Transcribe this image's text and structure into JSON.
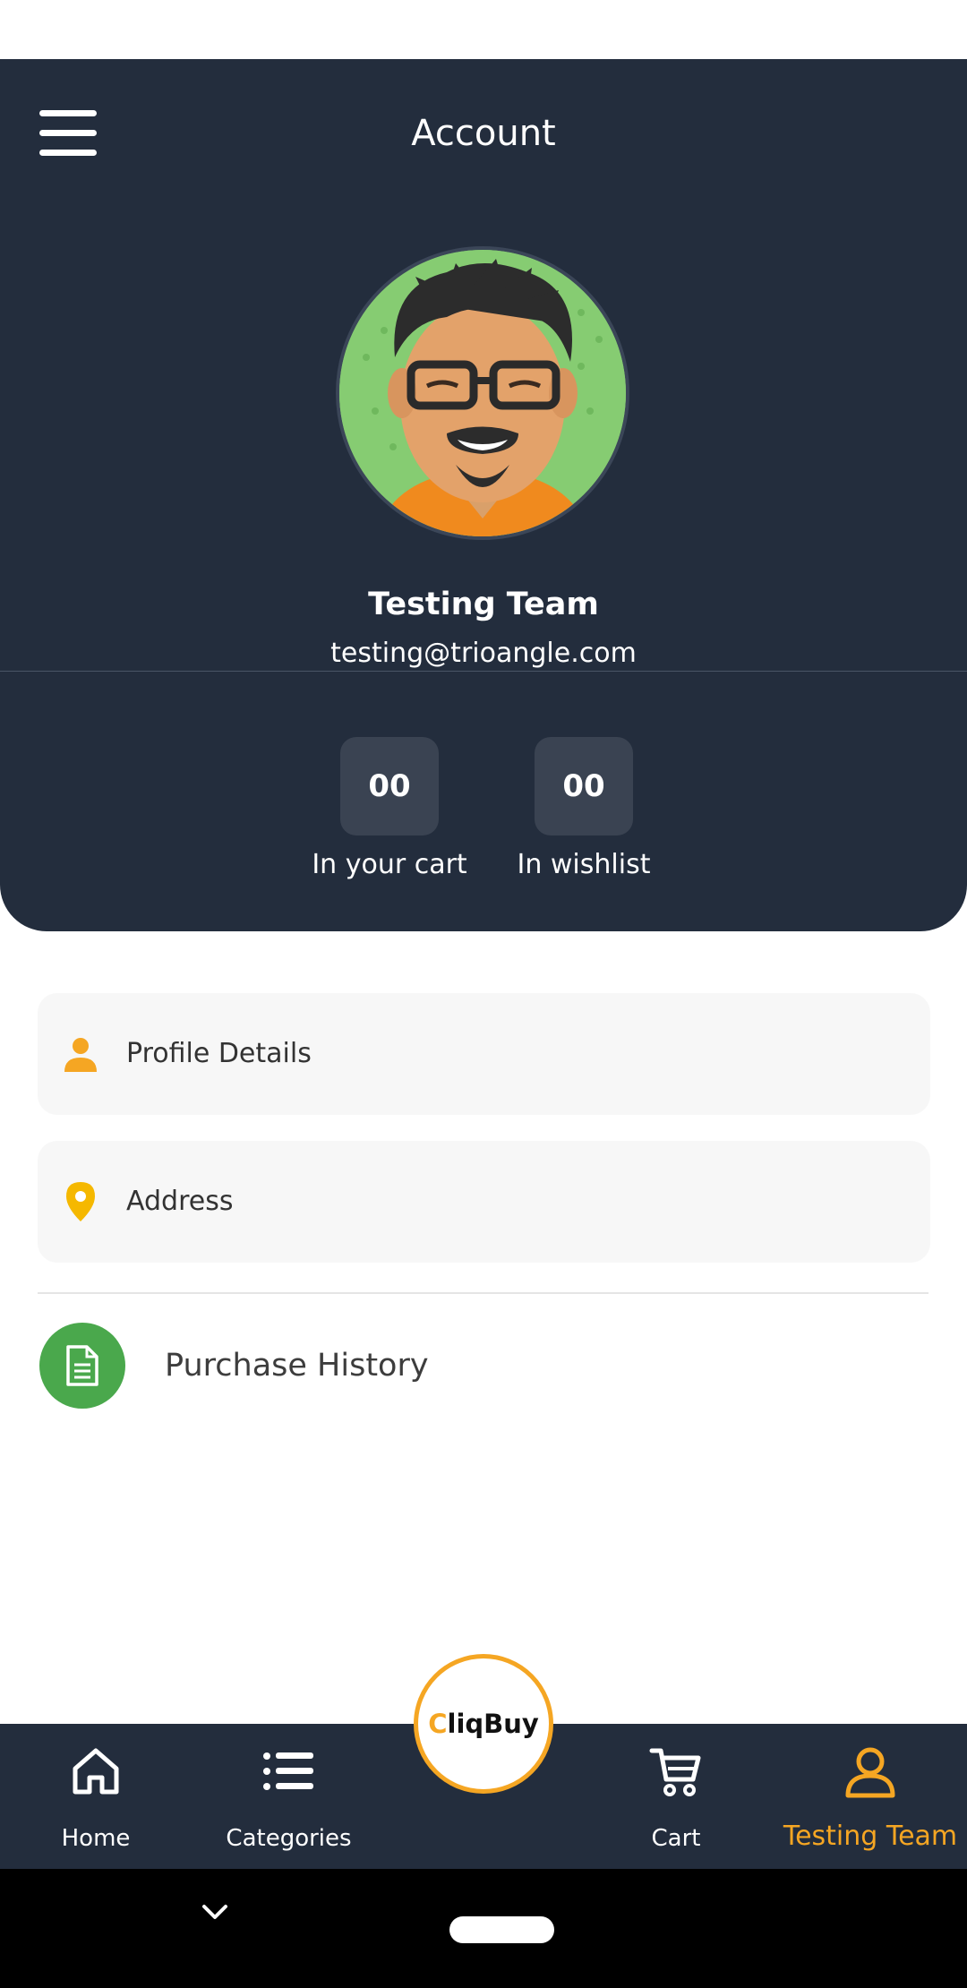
{
  "header": {
    "title": "Account"
  },
  "profile": {
    "name": "Testing Team",
    "email": "testing@trioangle.com"
  },
  "stats": [
    {
      "value": "00",
      "label": "In your cart"
    },
    {
      "value": "00",
      "label": "In wishlist"
    }
  ],
  "menu": {
    "profile_details": "Profile Details",
    "address": "Address",
    "purchase_history": "Purchase History"
  },
  "bottom_nav": {
    "home": "Home",
    "categories": "Categories",
    "cart": "Cart",
    "account": "Testing Team",
    "logo_c": "C",
    "logo_rest": "liqBuy"
  },
  "colors": {
    "header_bg": "#232d3d",
    "accent": "#f5a623",
    "address_pin": "#f5b800",
    "purchase_green": "#4aa84c"
  },
  "icons": {
    "menu": "hamburger-icon",
    "profile": "person-icon",
    "address": "location-pin-icon",
    "purchase": "document-icon",
    "home": "home-icon",
    "categories": "list-icon",
    "cart": "cart-icon",
    "account": "person-outline-icon"
  }
}
